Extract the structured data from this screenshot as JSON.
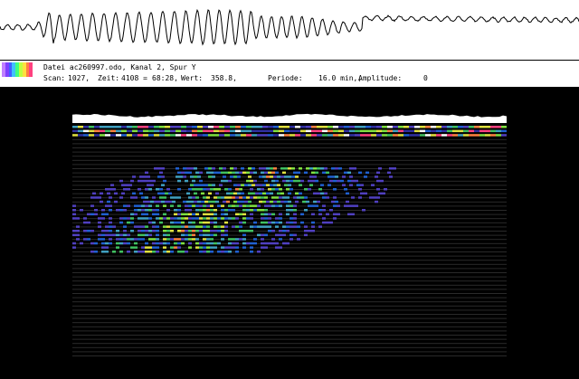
{
  "info": {
    "file_line": "Datei ac260997.odo, Kanal 2, Spur Y",
    "scan_label": "Scan:",
    "scan_value": "1027,",
    "zeit_label": "Zeit:",
    "zeit_value": "4108 =",
    "zeit_hms": "68:28,",
    "wert_label": "Wert:",
    "wert_value": "358.8,",
    "periode_label": "Periode:",
    "periode_value": "16.0 min,,",
    "amplitude_label": "Amplitude:",
    "amplitude_value": "0"
  },
  "colors": {
    "scale": [
      "#c080ff",
      "#8040ff",
      "#4060ff",
      "#40c0ff",
      "#40ff80",
      "#c0ff40",
      "#ffe040",
      "#ff8040",
      "#ff4080",
      "#ffffff"
    ]
  }
}
